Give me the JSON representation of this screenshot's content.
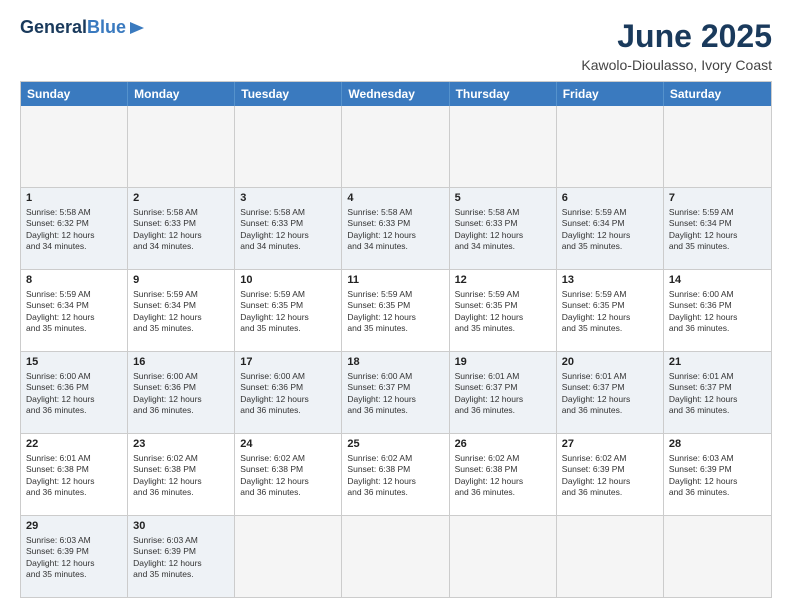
{
  "header": {
    "logo_line1": "General",
    "logo_line2": "Blue",
    "title": "June 2025",
    "subtitle": "Kawolo-Dioulasso, Ivory Coast"
  },
  "calendar": {
    "days_of_week": [
      "Sunday",
      "Monday",
      "Tuesday",
      "Wednesday",
      "Thursday",
      "Friday",
      "Saturday"
    ],
    "weeks": [
      [
        {
          "num": "",
          "empty": true
        },
        {
          "num": "",
          "empty": true
        },
        {
          "num": "",
          "empty": true
        },
        {
          "num": "",
          "empty": true
        },
        {
          "num": "",
          "empty": true
        },
        {
          "num": "",
          "empty": true
        },
        {
          "num": "",
          "empty": true
        }
      ],
      [
        {
          "num": "1",
          "rise": "5:58 AM",
          "set": "6:32 PM",
          "hours": "12 hours",
          "mins": "and 34 minutes."
        },
        {
          "num": "2",
          "rise": "5:58 AM",
          "set": "6:33 PM",
          "hours": "12 hours",
          "mins": "and 34 minutes."
        },
        {
          "num": "3",
          "rise": "5:58 AM",
          "set": "6:33 PM",
          "hours": "12 hours",
          "mins": "and 34 minutes."
        },
        {
          "num": "4",
          "rise": "5:58 AM",
          "set": "6:33 PM",
          "hours": "12 hours",
          "mins": "and 34 minutes."
        },
        {
          "num": "5",
          "rise": "5:58 AM",
          "set": "6:33 PM",
          "hours": "12 hours",
          "mins": "and 34 minutes."
        },
        {
          "num": "6",
          "rise": "5:59 AM",
          "set": "6:34 PM",
          "hours": "12 hours",
          "mins": "and 35 minutes."
        },
        {
          "num": "7",
          "rise": "5:59 AM",
          "set": "6:34 PM",
          "hours": "12 hours",
          "mins": "and 35 minutes."
        }
      ],
      [
        {
          "num": "8",
          "rise": "5:59 AM",
          "set": "6:34 PM",
          "hours": "12 hours",
          "mins": "and 35 minutes."
        },
        {
          "num": "9",
          "rise": "5:59 AM",
          "set": "6:34 PM",
          "hours": "12 hours",
          "mins": "and 35 minutes."
        },
        {
          "num": "10",
          "rise": "5:59 AM",
          "set": "6:35 PM",
          "hours": "12 hours",
          "mins": "and 35 minutes."
        },
        {
          "num": "11",
          "rise": "5:59 AM",
          "set": "6:35 PM",
          "hours": "12 hours",
          "mins": "and 35 minutes."
        },
        {
          "num": "12",
          "rise": "5:59 AM",
          "set": "6:35 PM",
          "hours": "12 hours",
          "mins": "and 35 minutes."
        },
        {
          "num": "13",
          "rise": "5:59 AM",
          "set": "6:35 PM",
          "hours": "12 hours",
          "mins": "and 35 minutes."
        },
        {
          "num": "14",
          "rise": "6:00 AM",
          "set": "6:36 PM",
          "hours": "12 hours",
          "mins": "and 36 minutes."
        }
      ],
      [
        {
          "num": "15",
          "rise": "6:00 AM",
          "set": "6:36 PM",
          "hours": "12 hours",
          "mins": "and 36 minutes."
        },
        {
          "num": "16",
          "rise": "6:00 AM",
          "set": "6:36 PM",
          "hours": "12 hours",
          "mins": "and 36 minutes."
        },
        {
          "num": "17",
          "rise": "6:00 AM",
          "set": "6:36 PM",
          "hours": "12 hours",
          "mins": "and 36 minutes."
        },
        {
          "num": "18",
          "rise": "6:00 AM",
          "set": "6:37 PM",
          "hours": "12 hours",
          "mins": "and 36 minutes."
        },
        {
          "num": "19",
          "rise": "6:01 AM",
          "set": "6:37 PM",
          "hours": "12 hours",
          "mins": "and 36 minutes."
        },
        {
          "num": "20",
          "rise": "6:01 AM",
          "set": "6:37 PM",
          "hours": "12 hours",
          "mins": "and 36 minutes."
        },
        {
          "num": "21",
          "rise": "6:01 AM",
          "set": "6:37 PM",
          "hours": "12 hours",
          "mins": "and 36 minutes."
        }
      ],
      [
        {
          "num": "22",
          "rise": "6:01 AM",
          "set": "6:38 PM",
          "hours": "12 hours",
          "mins": "and 36 minutes."
        },
        {
          "num": "23",
          "rise": "6:02 AM",
          "set": "6:38 PM",
          "hours": "12 hours",
          "mins": "and 36 minutes."
        },
        {
          "num": "24",
          "rise": "6:02 AM",
          "set": "6:38 PM",
          "hours": "12 hours",
          "mins": "and 36 minutes."
        },
        {
          "num": "25",
          "rise": "6:02 AM",
          "set": "6:38 PM",
          "hours": "12 hours",
          "mins": "and 36 minutes."
        },
        {
          "num": "26",
          "rise": "6:02 AM",
          "set": "6:38 PM",
          "hours": "12 hours",
          "mins": "and 36 minutes."
        },
        {
          "num": "27",
          "rise": "6:02 AM",
          "set": "6:39 PM",
          "hours": "12 hours",
          "mins": "and 36 minutes."
        },
        {
          "num": "28",
          "rise": "6:03 AM",
          "set": "6:39 PM",
          "hours": "12 hours",
          "mins": "and 36 minutes."
        }
      ],
      [
        {
          "num": "29",
          "rise": "6:03 AM",
          "set": "6:39 PM",
          "hours": "12 hours",
          "mins": "and 35 minutes."
        },
        {
          "num": "30",
          "rise": "6:03 AM",
          "set": "6:39 PM",
          "hours": "12 hours",
          "mins": "and 35 minutes."
        },
        {
          "num": "",
          "empty": true
        },
        {
          "num": "",
          "empty": true
        },
        {
          "num": "",
          "empty": true
        },
        {
          "num": "",
          "empty": true
        },
        {
          "num": "",
          "empty": true
        }
      ]
    ]
  }
}
